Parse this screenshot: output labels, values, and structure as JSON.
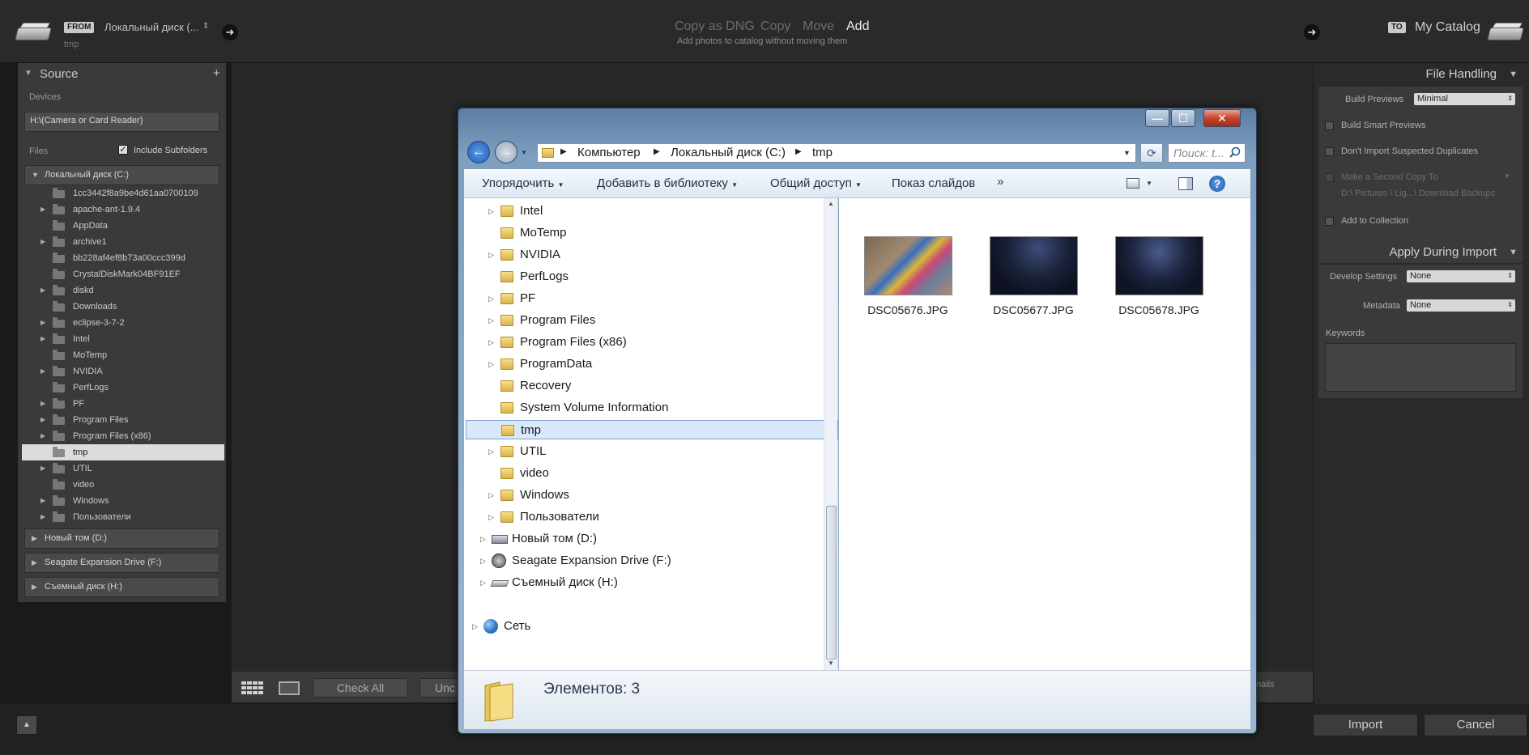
{
  "topbar": {
    "from_tag": "FROM",
    "from_source": "Локальный диск (...",
    "from_sub": "tmp",
    "modes": [
      "Copy as DNG",
      "Copy",
      "Move",
      "Add"
    ],
    "mode_subtitle": "Add photos to catalog without moving them",
    "to_tag": "TO",
    "to_target": "My Catalog"
  },
  "source": {
    "title": "Source",
    "devices_label": "Devices",
    "device": "H:\\(Camera or Card Reader)",
    "files_label": "Files",
    "include_subfolders": "Include Subfolders",
    "drive_c": "Локальный диск (C:)",
    "folders": [
      "1cc3442f8a9be4d61aa0700109",
      "apache-ant-1.9.4",
      "AppData",
      "archive1",
      "bb228af4ef8b73a00ccc399d",
      "CrystalDiskMark04BF91EF",
      "diskd",
      "Downloads",
      "eclipse-3-7-2",
      "Intel",
      "MoTemp",
      "NVIDIA",
      "PerfLogs",
      "PF",
      "Program Files",
      "Program Files (x86)",
      "tmp",
      "UTIL",
      "video",
      "Windows",
      "Пользователи"
    ],
    "drive_d": "Новый том (D:)",
    "drive_f": "Seagate Expansion Drive (F:)",
    "drive_h": "Съемный диск (H:)"
  },
  "center": {
    "check_all": "Check All",
    "uncheck_partial": "Unc",
    "thumbnails_partial": "nails"
  },
  "file_handling": {
    "title": "File Handling",
    "build_previews_label": "Build Previews",
    "build_previews_value": "Minimal",
    "smart_previews": "Build Smart Previews",
    "no_duplicates": "Don't Import Suspected Duplicates",
    "second_copy": "Make a Second Copy To :",
    "second_copy_path": "D:\\ Pictures \\ Lig...\\ Download Backups",
    "add_to_collection": "Add to Collection"
  },
  "apply_during_import": {
    "title": "Apply During Import",
    "develop_label": "Develop Settings",
    "develop_value": "None",
    "metadata_label": "Metadata",
    "metadata_value": "None",
    "keywords_label": "Keywords"
  },
  "bottom": {
    "import": "Import",
    "cancel": "Cancel"
  },
  "dialog": {
    "minimize": "—",
    "maximize": "☐",
    "close": "✕",
    "breadcrumb": [
      "Компьютер",
      "Локальный диск (C:)",
      "tmp"
    ],
    "search_placeholder": "Поиск: t...",
    "toolbar": [
      "Упорядочить",
      "Добавить в библиотеку",
      "Общий доступ",
      "Показ слайдов"
    ],
    "more": "»",
    "help": "?",
    "tree": [
      "Intel",
      "MoTemp",
      "NVIDIA",
      "PerfLogs",
      "PF",
      "Program Files",
      "Program Files (x86)",
      "ProgramData",
      "Recovery",
      "System Volume Information",
      "tmp",
      "UTIL",
      "video",
      "Windows",
      "Пользователи"
    ],
    "tree_drives": [
      "Новый том (D:)",
      "Seagate Expansion Drive (F:)",
      "Съемный диск (H:)"
    ],
    "network": "Сеть",
    "files": [
      "DSC05676.JPG",
      "DSC05677.JPG",
      "DSC05678.JPG"
    ],
    "status": "Элементов: 3"
  },
  "colors": {
    "lr_dark": "#2a2a2a",
    "lr_panel": "#3a3a3a",
    "win_selection": "#d9e8fb",
    "win_border": "#5b7ea3"
  }
}
